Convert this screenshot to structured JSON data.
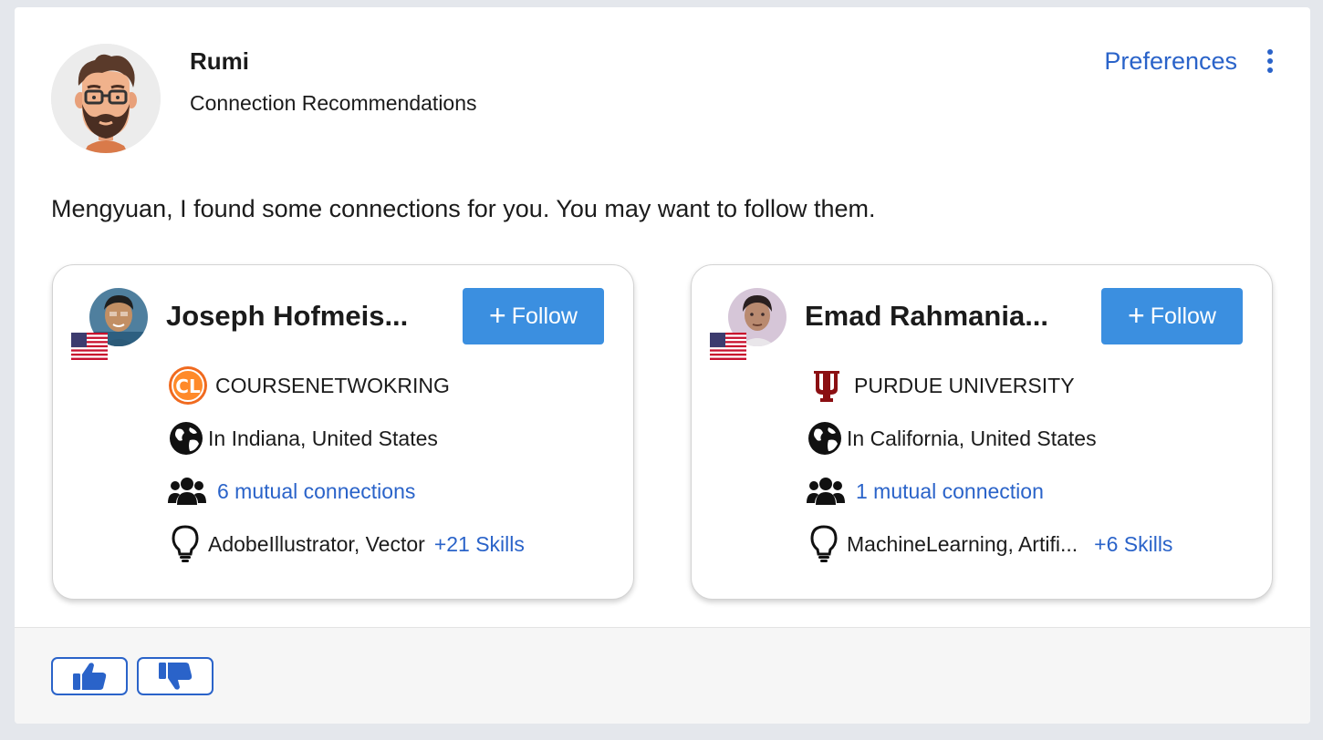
{
  "bot": {
    "name": "Rumi",
    "subtitle": "Connection Recommendations"
  },
  "header": {
    "preferences_label": "Preferences"
  },
  "message": "Mengyuan, I found some connections for you. You may want to follow them.",
  "recommendations": [
    {
      "name": "Joseph Hofmeis...",
      "follow_label": "Follow",
      "organization": "COURSENETWOKRING",
      "location": "In Indiana, United States",
      "mutual": "6 mutual connections",
      "skills": "AdobeIllustrator, Vector",
      "skills_more": "+21 Skills"
    },
    {
      "name": "Emad Rahmania...",
      "follow_label": "Follow",
      "organization": "PURDUE UNIVERSITY",
      "location": "In California, United States",
      "mutual": "1 mutual connection",
      "skills": "MachineLearning, Artifi...",
      "skills_more": "+6 Skills"
    }
  ],
  "colors": {
    "accent": "#2a63c9",
    "follow_button": "#3b8fe0",
    "footer_bg": "#f6f6f6"
  },
  "icons": {
    "organization_1": "courselab-logo-icon",
    "organization_2": "indiana-trident-logo-icon",
    "location": "globe-icon",
    "mutual": "users-group-icon",
    "skills": "lightbulb-icon",
    "flag": "us-flag-icon",
    "vote_up": "thumbs-up-icon",
    "vote_down": "thumbs-down-icon"
  }
}
